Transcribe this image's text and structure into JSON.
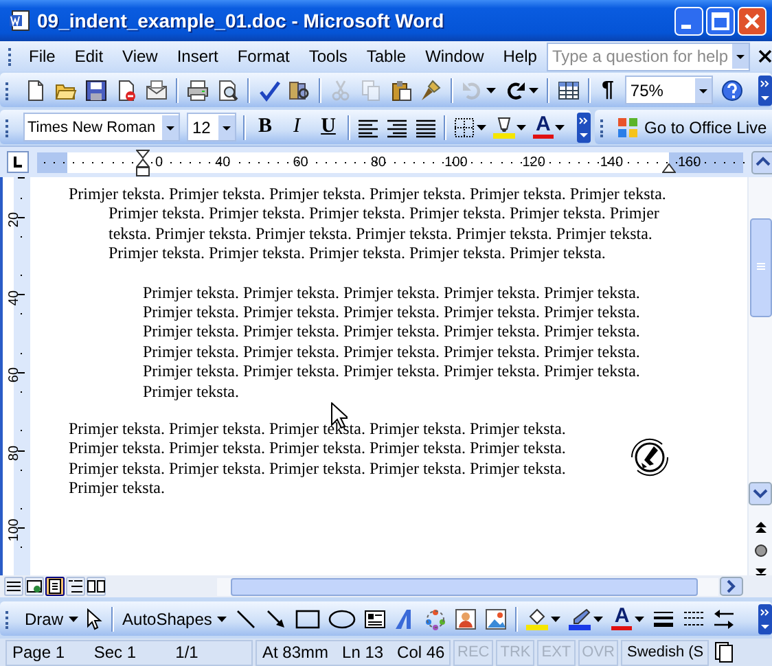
{
  "window": {
    "title": "09_indent_example_01.doc - Microsoft Word"
  },
  "menu_bar": {
    "items": [
      {
        "label": "File"
      },
      {
        "label": "Edit"
      },
      {
        "label": "View"
      },
      {
        "label": "Insert"
      },
      {
        "label": "Format"
      },
      {
        "label": "Tools"
      },
      {
        "label": "Table"
      },
      {
        "label": "Window"
      },
      {
        "label": "Help"
      }
    ],
    "help_box": {
      "placeholder": "Type a question for help"
    }
  },
  "standard_toolbar": {
    "cut": {
      "disabled": true
    },
    "copy": {
      "disabled": true
    },
    "undo": {
      "disabled": true
    },
    "redo": {
      "disabled": false
    },
    "show_hide": "¶",
    "zoom": "75%"
  },
  "formatting_toolbar": {
    "font": "Times New Roman",
    "size": "12",
    "bold": "B",
    "italic": "I",
    "underline": "U",
    "font_color": "A",
    "office_live": "Go to Office Live"
  },
  "ruler": {
    "labels": [
      "0",
      "40",
      "60",
      "80",
      "100",
      "120",
      "140",
      "160"
    ]
  },
  "vertical_ruler": {
    "labels": [
      "20",
      "40",
      "60",
      "80",
      "100"
    ]
  },
  "document": {
    "paragraphs": [
      {
        "kind": "hanging",
        "lines": [
          "Primjer teksta. Primjer teksta. Primjer teksta. Primjer teksta. Primjer teksta. Primjer teksta.",
          "Primjer teksta. Primjer teksta. Primjer teksta. Primjer teksta. Primjer teksta. Primjer",
          "teksta. Primjer teksta. Primjer teksta. Primjer teksta. Primjer teksta. Primjer teksta.",
          "Primjer teksta. Primjer teksta. Primjer teksta. Primjer teksta. Primjer teksta."
        ]
      },
      {
        "kind": "indented",
        "lines": [
          "Primjer teksta. Primjer teksta. Primjer teksta. Primjer teksta. Primjer teksta.",
          "Primjer teksta. Primjer teksta. Primjer teksta. Primjer teksta. Primjer teksta.",
          "Primjer teksta. Primjer teksta. Primjer teksta. Primjer teksta. Primjer teksta.",
          "Primjer teksta. Primjer teksta. Primjer teksta. Primjer teksta. Primjer teksta.",
          "Primjer teksta. Primjer teksta. Primjer teksta. Primjer teksta. Primjer teksta.",
          "Primjer teksta."
        ]
      },
      {
        "kind": "plain",
        "lines": [
          "Primjer teksta. Primjer teksta. Primjer teksta. Primjer teksta. Primjer teksta.",
          "Primjer teksta. Primjer teksta. Primjer teksta. Primjer teksta. Primjer teksta.",
          "Primjer teksta. Primjer teksta. Primjer teksta. Primjer teksta. Primjer teksta.",
          "Primjer teksta."
        ]
      }
    ]
  },
  "view_buttons": [
    {
      "kind": "normal",
      "selected": false
    },
    {
      "kind": "web",
      "selected": false
    },
    {
      "kind": "print",
      "selected": true
    },
    {
      "kind": "outline",
      "selected": false
    },
    {
      "kind": "reading",
      "selected": false
    }
  ],
  "drawing_toolbar": {
    "draw": "Draw",
    "autoshapes": "AutoShapes",
    "font_color": "A"
  },
  "status_bar": {
    "fields": [
      {
        "label": "Page 1"
      },
      {
        "label": "Sec 1"
      },
      {
        "label": "1/1"
      },
      {
        "label": "At 83mm"
      },
      {
        "label": "Ln 13"
      },
      {
        "label": "Col 46"
      }
    ],
    "modes": [
      {
        "label": "REC",
        "disabled": true
      },
      {
        "label": "TRK",
        "disabled": true
      },
      {
        "label": "EXT",
        "disabled": true
      },
      {
        "label": "OVR",
        "disabled": true
      }
    ],
    "language": "Swedish (S"
  }
}
